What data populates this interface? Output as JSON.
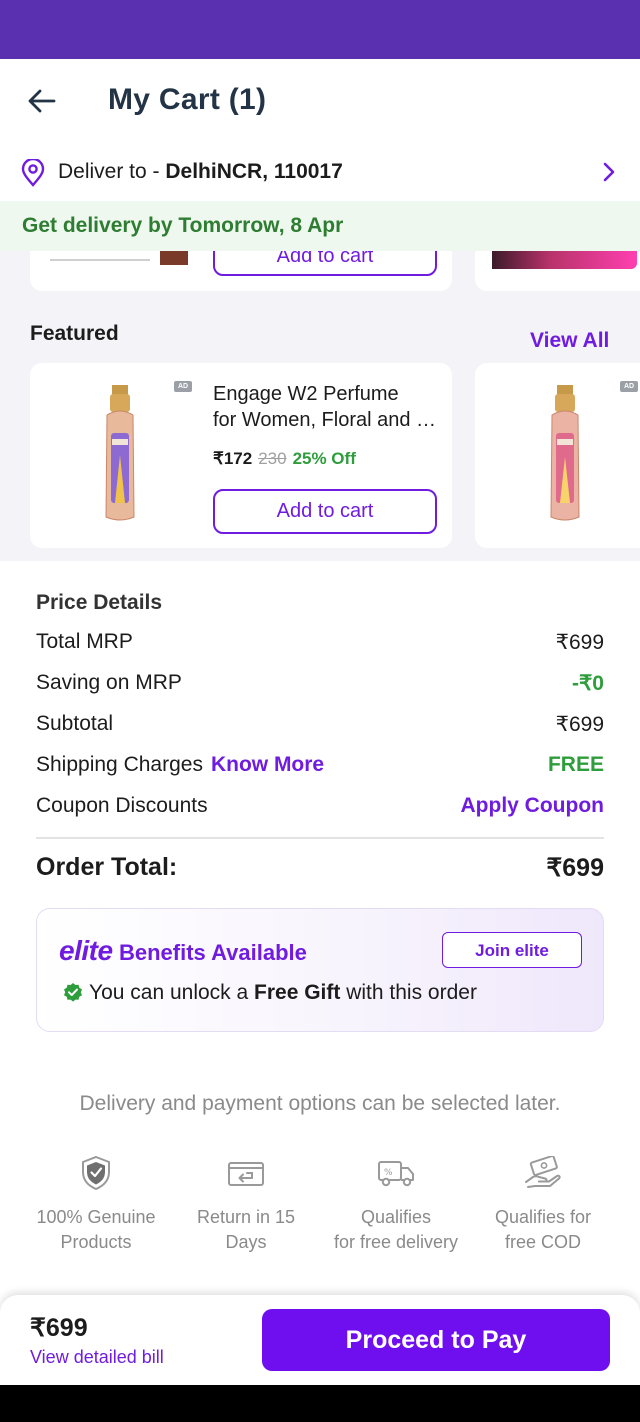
{
  "header": {
    "title": "My Cart (1)"
  },
  "delivery": {
    "deliver_prefix": "Deliver to - ",
    "location": "DelhiNCR, 110017",
    "banner": "Get delivery by Tomorrow, 8 Apr"
  },
  "previous_row": {
    "add_label": "Add to cart"
  },
  "featured": {
    "title": "Featured",
    "view_all": "View All",
    "ad_label": "AD",
    "products": [
      {
        "name_line1": "Engage W2 Perfume",
        "name_line2": "for Women, Floral and F...",
        "price": "₹172",
        "mrp": "230",
        "discount": "25% Off",
        "add_label": "Add to cart"
      }
    ]
  },
  "price_details": {
    "title": "Price Details",
    "rows": [
      {
        "label": "Total MRP",
        "value": "₹699"
      },
      {
        "label": "Saving on MRP",
        "value": "-₹0"
      },
      {
        "label": "Subtotal",
        "value": "₹699"
      },
      {
        "label": "Shipping Charges",
        "extra": "Know More",
        "value": "FREE"
      },
      {
        "label": "Coupon Discounts",
        "value": "Apply Coupon"
      }
    ],
    "order_total_label": "Order Total:",
    "order_total_value": "₹699"
  },
  "elite": {
    "brand": "elite",
    "benefits": "Benefits Available",
    "join": "Join elite",
    "gift_pre": "You can unlock a ",
    "gift_bold": "Free Gift",
    "gift_post": " with this order"
  },
  "select_later": "Delivery and payment options can be selected later.",
  "features": [
    {
      "icon": "shield-check-icon",
      "line1": "100% Genuine",
      "line2": "Products"
    },
    {
      "icon": "return-icon",
      "line1": "Return in 15",
      "line2": "Days"
    },
    {
      "icon": "delivery-truck-icon",
      "line1": "Qualifies",
      "line2": "for free delivery"
    },
    {
      "icon": "cash-hand-icon",
      "line1": "Qualifies for",
      "line2": "free COD"
    }
  ],
  "bottom": {
    "total": "₹699",
    "bill_link": "View detailed bill",
    "pay_label": "Proceed to Pay"
  },
  "colors": {
    "brand_purple": "#6f1ce0",
    "status_bar": "#5a2fb0",
    "green": "#2e9d3b",
    "banner_bg": "#eef8ee"
  }
}
